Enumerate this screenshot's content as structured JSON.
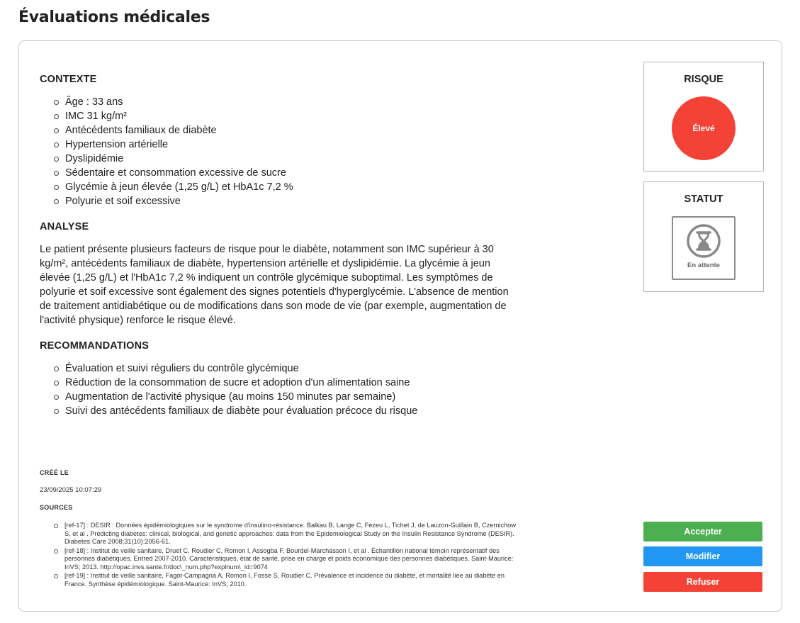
{
  "page": {
    "title": "Évaluations médicales"
  },
  "context": {
    "heading": "CONTEXTE",
    "items": [
      "Âge : 33 ans",
      "IMC 31 kg/m²",
      "Antécédents familiaux de diabète",
      "Hypertension artérielle",
      "Dyslipidémie",
      "Sédentaire et consommation excessive de sucre",
      "Glycémie à jeun élevée (1,25 g/L) et HbA1c 7,2 %",
      "Polyurie et soif excessive"
    ]
  },
  "analysis": {
    "heading": "ANALYSE",
    "text": "Le patient présente plusieurs facteurs de risque pour le diabète, notamment son IMC supérieur à 30 kg/m², antécédents familiaux de diabète, hypertension artérielle et dyslipidémie. La glycémie à jeun élevée (1,25 g/L) et l'HbA1c 7,2 % indiquent un contrôle glycémique suboptimal. Les symptômes de polyurie et soif excessive sont également des signes potentiels d'hyperglycémie. L'absence de mention de traitement antidiabétique ou de modifications dans son mode de vie (par exemple, augmentation de l'activité physique) renforce le risque élevé."
  },
  "recommendations": {
    "heading": "RECOMMANDATIONS",
    "items": [
      "Évaluation et suivi réguliers du contrôle glycémique",
      "Réduction de la consommation de sucre et adoption d'un alimentation saine",
      "Augmentation de l'activité physique (au moins 150 minutes par semaine)",
      "Suivi des antécédents familiaux de diabète pour évaluation précoce du risque"
    ]
  },
  "meta": {
    "created_label": "CRÉÉ LE",
    "created_value": "23/09/2025 10:07:29",
    "sources_label": "SOURCES",
    "sources": [
      "[ref-17] : DESIR : Données épidémiologiques sur le syndrome d'insulino-résistance. Balkau B, Lange C, Fezeu L, Tichet J, de Lauzon-Guillain B, Czernichow S, et al . Predicting diabetes: clinical, biological, and genetic approaches: data from the Epidemiological Study on the Insulin Resistance Syndrome (DESIR). Diabetes Care 2008;31(10):2056-61.",
      "[ref-18] : Institut de veille sanitaire, Druet C, Roudier C, Romon I, Assogba F, Bourdel-Marchasson I, et al . Échantillon national témoin représentatif des personnes diabétiques, Entred 2007-2010. Caractéristiques, état de santé, prise en charge et poids économique des personnes diabétiques. Saint-Maurice: InVS; 2013. http://opac.invs.sante.fr/doc\\_num.php?explnum\\_id=9074",
      "[ref-19] : Institut de veille sanitaire, Fagot-Campagna A, Romon I, Fosse S, Roudier C. Prévalence et incidence du diabète, et mortalité liée au diabète en France. Synthèse épidémiologique. Saint-Maurice: InVS; 2010."
    ]
  },
  "risk": {
    "title": "RISQUE",
    "level": "Élevé",
    "color": "#f44336"
  },
  "status": {
    "title": "STATUT",
    "value": "En attente",
    "icon": "hourglass-icon",
    "color": "#8a8a8a"
  },
  "actions": {
    "accept": {
      "label": "Accepter",
      "color": "#4caf50"
    },
    "modify": {
      "label": "Modifier",
      "color": "#2196f3"
    },
    "reject": {
      "label": "Refuser",
      "color": "#f44336"
    }
  }
}
